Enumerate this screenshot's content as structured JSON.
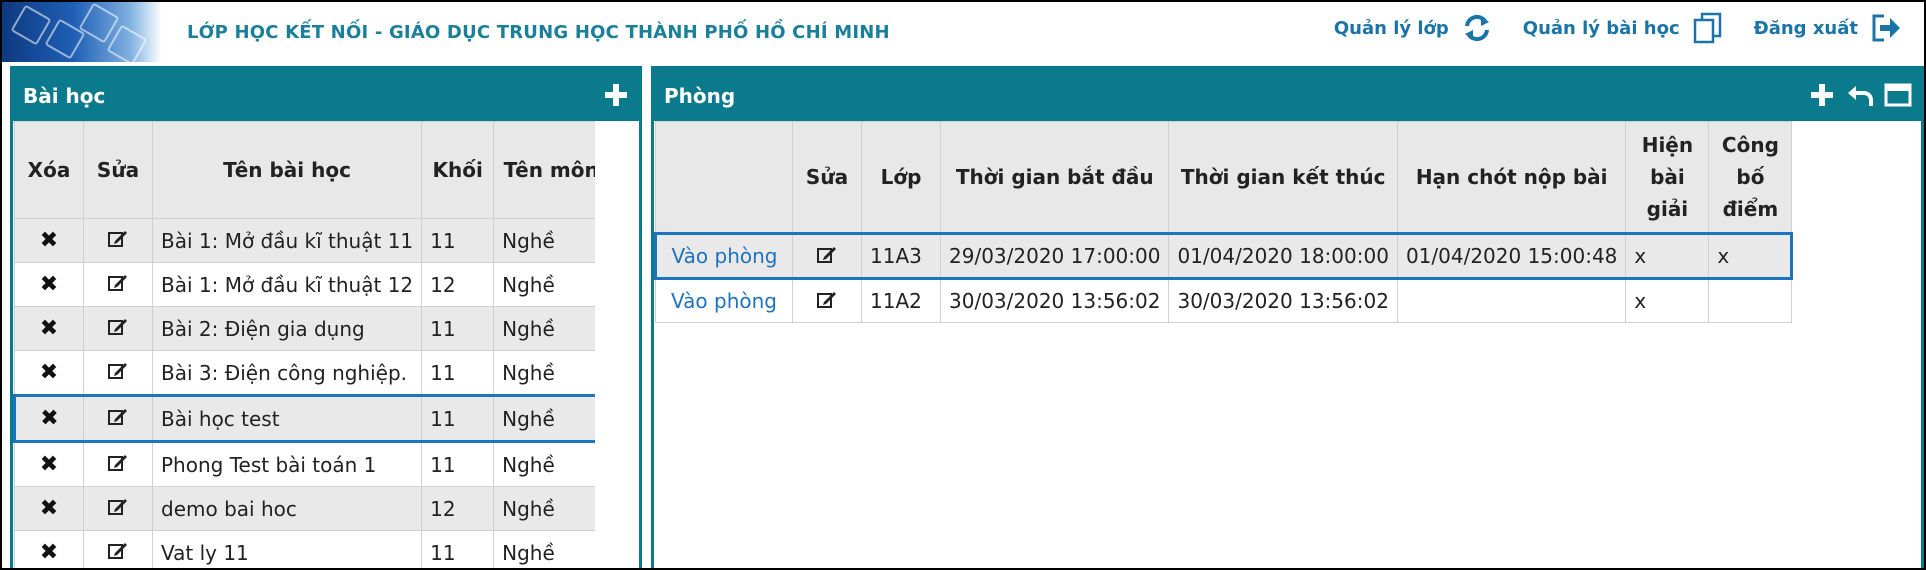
{
  "header": {
    "title": "LỚP HỌC KẾT NỐI -  GIÁO DỤC TRUNG HỌC THÀNH PHỐ HỒ CHÍ MINH",
    "nav": [
      {
        "label": "Quản lý lớp",
        "icon": "refresh-icon"
      },
      {
        "label": "Quản lý bài học",
        "icon": "copy-icon"
      },
      {
        "label": "Đăng xuất",
        "icon": "logout-icon"
      }
    ]
  },
  "lessons_panel": {
    "title": "Bài học",
    "columns": [
      "Xóa",
      "Sửa",
      "Tên bài học",
      "Khối",
      "Tên môn"
    ],
    "rows": [
      {
        "name": "Bài 1: Mở đầu kĩ thuật 11",
        "grade": "11",
        "subject": "Nghề"
      },
      {
        "name": "Bài 1: Mở đầu kĩ thuật 12",
        "grade": "12",
        "subject": "Nghề"
      },
      {
        "name": "Bài 2: Điện gia dụng",
        "grade": "11",
        "subject": "Nghề"
      },
      {
        "name": "Bài 3: Điện công nghiệp.",
        "grade": "11",
        "subject": "Nghề"
      },
      {
        "name": "Bài học test",
        "grade": "11",
        "subject": "Nghề"
      },
      {
        "name": "Phong Test bài toán 1",
        "grade": "11",
        "subject": "Nghề"
      },
      {
        "name": "demo bai hoc",
        "grade": "12",
        "subject": "Nghề"
      },
      {
        "name": "Vat ly 11",
        "grade": "11",
        "subject": "Nghề"
      }
    ]
  },
  "rooms_panel": {
    "title": "Phòng",
    "columns": [
      "",
      "Sửa",
      "Lớp",
      "Thời gian bắt đầu",
      "Thời gian kết thúc",
      "Hạn chót nộp bài",
      "Hiện bài giải",
      "Công bố điểm"
    ],
    "rows": [
      {
        "enter": "Vào phòng",
        "class": "11A3",
        "start": "29/03/2020 17:00:00",
        "end": "01/04/2020 18:00:00",
        "deadline": "01/04/2020 15:00:48",
        "show_solution": "x",
        "publish_score": "x"
      },
      {
        "enter": "Vào phòng",
        "class": "11A2",
        "start": "30/03/2020 13:56:02",
        "end": "30/03/2020 13:56:02",
        "deadline": "",
        "show_solution": "x",
        "publish_score": ""
      }
    ]
  },
  "colors": {
    "accent": "#0b7a8c",
    "link": "#1e73be",
    "selection": "#1e73be"
  }
}
